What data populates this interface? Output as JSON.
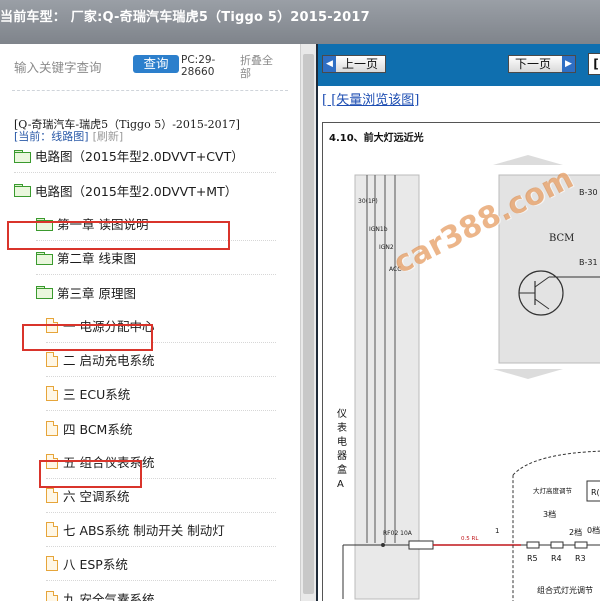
{
  "titlebar": {
    "title": "当前车型： 厂家:Q-奇瑞汽车瑞虎5（Tiggo 5）2015-2017"
  },
  "search": {
    "placeholder": "输入关键字查询",
    "query_label": "查询",
    "pc_line1": "PC:29-",
    "pc_line2": "28660",
    "collapse_label": "折叠全部"
  },
  "breadcrumb": {
    "line1": "[Q-奇瑞汽车-瑞虎5（Tiggo 5）-2015-2017]",
    "current": "[当前：线路图]",
    "refresh": "[刷新]"
  },
  "tree": {
    "items": [
      {
        "label": "电路图（2015年型2.0DVVT+CVT）",
        "type": "folder"
      },
      {
        "label": "电路图（2015年型2.0DVVT+MT）",
        "type": "folder"
      },
      {
        "label": "第一章 读图说明",
        "type": "folder"
      },
      {
        "label": "第二章 线束图",
        "type": "folder"
      },
      {
        "label": "第三章 原理图",
        "type": "folder"
      },
      {
        "label": "一 电源分配中心",
        "type": "doc"
      },
      {
        "label": "二 启动充电系统",
        "type": "doc"
      },
      {
        "label": "三 ECU系统",
        "type": "doc"
      },
      {
        "label": "四 BCM系统",
        "type": "doc"
      },
      {
        "label": "五 组合仪表系统",
        "type": "doc"
      },
      {
        "label": "六 空调系统",
        "type": "doc"
      },
      {
        "label": "七 ABS系统 制动开关 制动灯",
        "type": "doc"
      },
      {
        "label": "八 ESP系统",
        "type": "doc"
      },
      {
        "label": "九 安全气囊系统",
        "type": "doc"
      }
    ]
  },
  "nav": {
    "prev_label": "上一页",
    "next_label": "下一页",
    "extra": "["
  },
  "vector_link": "[ [矢量浏览该图]",
  "diagram": {
    "title": "4.10、前大灯远近光",
    "labels": {
      "b30": "B-30",
      "b31": "B-31",
      "bcm": "BCM",
      "ign": [
        "30(1P)",
        "IGN1b",
        "IGN2",
        "ACC"
      ],
      "box_side": [
        "仪",
        "表",
        "电",
        "器",
        "盒",
        "A"
      ],
      "fuse": "RF02  10A",
      "wire": "0.5 RL",
      "pin1": "1",
      "lamp_adj": "大灯高度调节",
      "r_partial": "R(",
      "gear3": "3档",
      "gear2": "2档",
      "gear0": "0档",
      "r5": "R5",
      "r4": "R4",
      "r3": "R3",
      "bottom": "组合式灯光调节"
    }
  },
  "watermark": "car388.com"
}
